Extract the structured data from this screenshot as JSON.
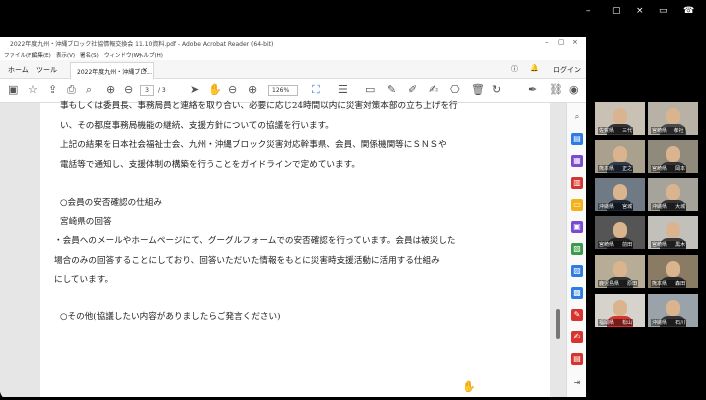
{
  "window": {
    "title": "2022年度九州・沖縄ブロック社協情報交換会 11.10資料.pdf - Adobe Acrobat Reader (64-bit)"
  },
  "menu": [
    "ファイル(F)",
    "編集(E)",
    "表示(V)",
    "署名(S)",
    "ウィンドウ(W)",
    "ヘルプ(H)"
  ],
  "tabs": {
    "home": "ホーム",
    "tools": "ツール",
    "document": "2022年度九州・沖縄ブロ...",
    "login": "ログイン"
  },
  "toolbar": {
    "current_page": "3",
    "total_pages": "/ 3",
    "zoom": "126%"
  },
  "document": {
    "lines": [
      "事もしくは委員長、事務局員と連絡を取り合い、必要に応じ24時間以内に災害対策本部の立ち上げを行",
      "い、その都度事務局機能の継続、支援方針についての協議を行います。",
      "上記の結果を日本社会福祉士会、九州・沖縄ブロック災害対応幹事県、会員、関係機関等にＳＮＳや",
      "電話等で通知し、支援体制の構築を行うことをガイドラインで定めています。",
      "",
      "○会員の安否確認の仕組み",
      "宮崎県の回答",
      "・会員へのメールやホームページにて、グーグルフォームでの安否確認を行っています。会員は被災した",
      "  場合のみの回答することにしており、回答いただいた情報をもとに災害時支援活動に活用する仕組み",
      "  にしています。",
      "",
      "○その他(協議したい内容がありましたらご発言ください)"
    ]
  },
  "participants": [
    {
      "name": "佐賀県 　 三代"
    },
    {
      "name": "宮崎県　 孝社"
    },
    {
      "name": "熊本県 　 正之"
    },
    {
      "name": "宮崎県 　 岡本"
    },
    {
      "name": "沖縄県 　 宮城"
    },
    {
      "name": "沖縄県 　 大城"
    },
    {
      "name": "宮崎県 　 前田"
    },
    {
      "name": "宮崎県 　 黒木"
    },
    {
      "name": "鹿児島県 　 原田"
    },
    {
      "name": "熊本県 　 森田"
    },
    {
      "name": "福岡県 　 松山"
    },
    {
      "name": "沖縄県 　 石川"
    }
  ],
  "colors": {
    "accent_red": "#d7332f",
    "acrobat_blue": "#2d7be5",
    "window_bg": "#000000"
  }
}
